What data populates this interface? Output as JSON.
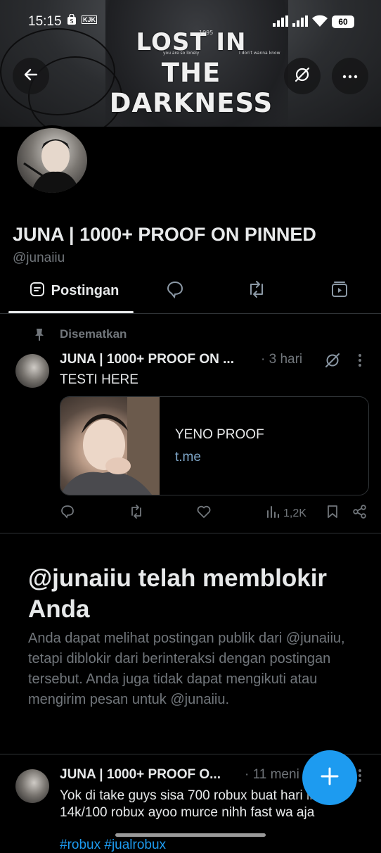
{
  "status_bar": {
    "time": "15:15",
    "app_badge": "KJK",
    "battery": "60"
  },
  "banner": {
    "title_line1": "LOST IN",
    "title_line2": "THE DARKNESS",
    "year": "1995",
    "small_text_right": "I don't wanna know",
    "small_text_left": "you are so lonely"
  },
  "profile": {
    "display_name": "JUNA | 1000+ PROOF ON PINNED",
    "handle": "@junaiiu"
  },
  "tabs": {
    "posts_label": "Postingan"
  },
  "pinned_post": {
    "pinned_label": "Disematkan",
    "author": "JUNA | 1000+ PROOF ON ...",
    "time": "· 3 hari",
    "text": "TESTI HERE",
    "card_title": "YENO PROOF",
    "card_domain": "t.me",
    "views": "1,2K"
  },
  "blocked": {
    "title": "@junaiiu telah memblokir Anda",
    "description": "Anda dapat melihat postingan publik dari @junaiiu, tetapi diblokir dari berinteraksi dengan postingan tersebut. Anda juga tidak dapat mengikuti atau mengirim pesan untuk @junaiiu."
  },
  "second_post": {
    "author": "JUNA | 1000+ PROOF O...",
    "time": "· 11 meni",
    "text": "Yok di take guys sisa 700 robux buat hari ini aja 14k/100 robux ayoo murce nihh fast wa aja",
    "hashtags": "#robux #jualrobux"
  },
  "colors": {
    "accent": "#1d9bf0",
    "background": "#000000",
    "muted": "#71767b",
    "divider": "#2f3336"
  }
}
